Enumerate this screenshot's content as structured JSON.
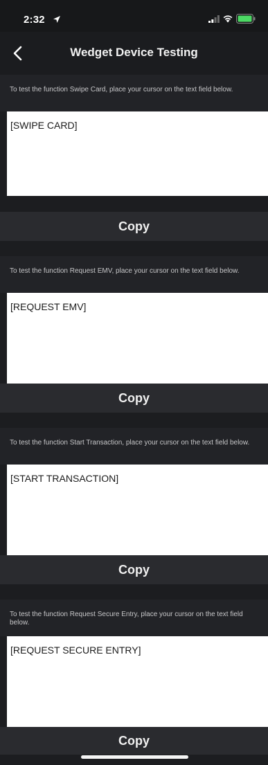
{
  "status_bar": {
    "time": "2:32",
    "icons": [
      "location-arrow-icon",
      "cellular-signal-icon",
      "wifi-icon",
      "battery-icon"
    ]
  },
  "nav": {
    "back_icon": "chevron-left-icon",
    "title": "Wedget Device Testing"
  },
  "sections": [
    {
      "instruction": "To test the function Swipe Card, place your cursor on the text field below.",
      "field_value": "[SWIPE CARD]",
      "button_label": "Copy"
    },
    {
      "instruction": "To test the function Request EMV, place your cursor on the text field below.",
      "field_value": "[REQUEST EMV]",
      "button_label": "Copy"
    },
    {
      "instruction": "To test the function Start Transaction, place your cursor on the text field below.",
      "field_value": "[START TRANSACTION]",
      "button_label": "Copy"
    },
    {
      "instruction": "To test the function Request Secure Entry, place your cursor on the text field below.",
      "field_value": "[REQUEST SECURE ENTRY]",
      "button_label": "Copy"
    }
  ],
  "colors": {
    "background": "#1c1d20",
    "instruction_background": "#222327",
    "button_background": "#2a2b2f",
    "field_background": "#ffffff",
    "battery_accent": "#4cd964"
  }
}
